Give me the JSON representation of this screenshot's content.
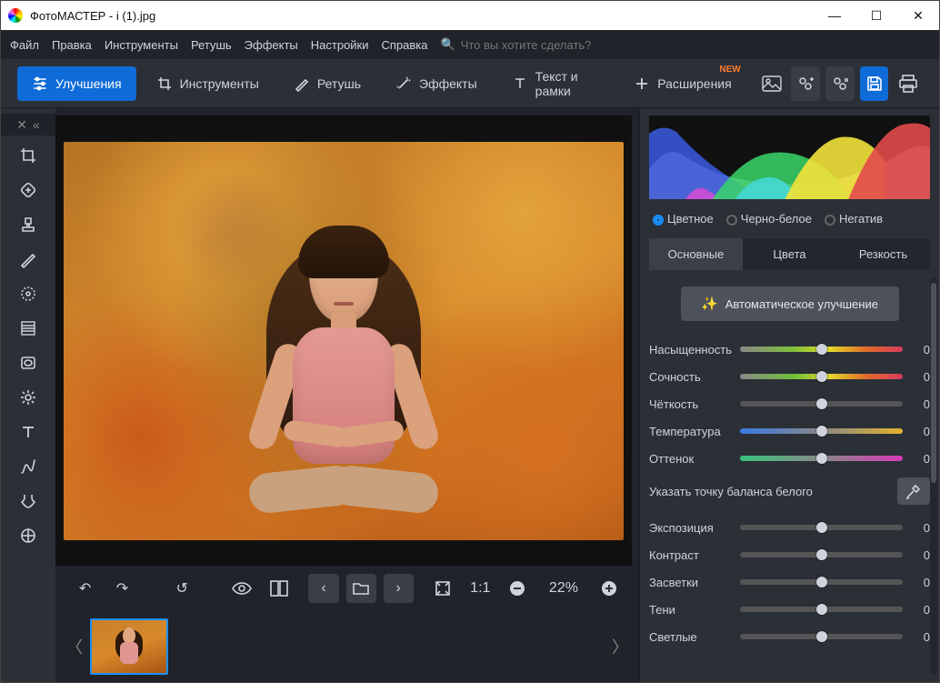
{
  "titlebar": {
    "title": "ФотоМАСТЕР - i (1).jpg"
  },
  "menubar": {
    "items": [
      "Файл",
      "Правка",
      "Инструменты",
      "Ретушь",
      "Эффекты",
      "Настройки",
      "Справка"
    ],
    "search_placeholder": "Что вы хотите сделать?"
  },
  "toolbar": {
    "enhance": "Улучшения",
    "tools": "Инструменты",
    "retouch": "Ретушь",
    "effects": "Эффекты",
    "text": "Текст и рамки",
    "ext": "Расширения",
    "new": "NEW"
  },
  "bottombar": {
    "zoom": "22%",
    "oneToOne": "1:1"
  },
  "right": {
    "radios": {
      "color": "Цветное",
      "bw": "Черно-белое",
      "neg": "Негатив"
    },
    "tabs": {
      "basic": "Основные",
      "color": "Цвета",
      "sharp": "Резкость"
    },
    "auto": "Автоматическое улучшение",
    "sliders": {
      "saturation": {
        "label": "Насыщенность",
        "value": "0"
      },
      "vibrance": {
        "label": "Сочность",
        "value": "0"
      },
      "clarity": {
        "label": "Чёткость",
        "value": "0"
      },
      "temperature": {
        "label": "Температура",
        "value": "0"
      },
      "tint": {
        "label": "Оттенок",
        "value": "0"
      },
      "exposure": {
        "label": "Экспозиция",
        "value": "0"
      },
      "contrast": {
        "label": "Контраст",
        "value": "0"
      },
      "highlights": {
        "label": "Засветки",
        "value": "0"
      },
      "shadows": {
        "label": "Тени",
        "value": "0"
      },
      "whites": {
        "label": "Светлые",
        "value": "0"
      }
    },
    "whitebalance": "Указать точку баланса белого"
  }
}
